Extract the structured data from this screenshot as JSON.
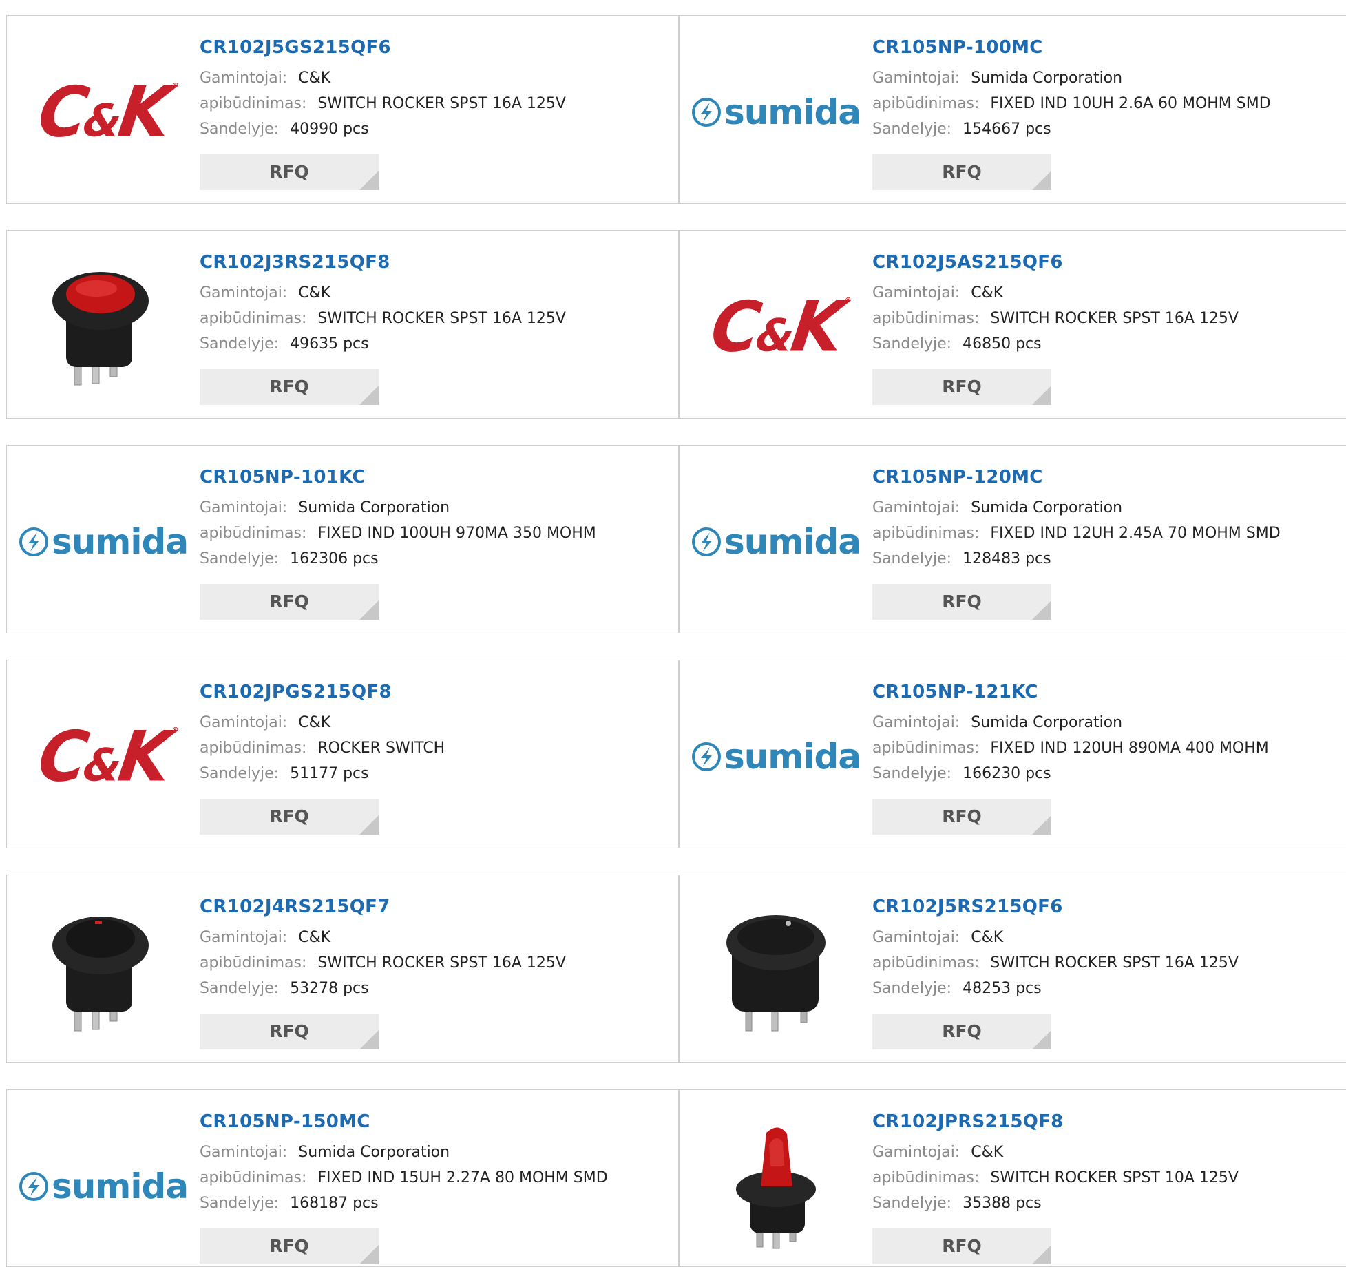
{
  "labels": {
    "manufacturer": "Gamintojai:",
    "description": "apibūdinimas:",
    "stock": "Sandelyje:",
    "rfq": "RFQ"
  },
  "brand_logos": {
    "ck": {
      "text_c": "C",
      "text_amp": "&",
      "text_k": "K",
      "reg": "®",
      "color": "#c8202a"
    },
    "sumida": {
      "text": "sumida",
      "color": "#2e87b8"
    }
  },
  "colors": {
    "part_number": "#1e6ab0",
    "label": "#8a8a8a",
    "value": "#222222",
    "rfq_bg": "#ececec",
    "border": "#cfcfcf"
  },
  "products": [
    {
      "part": "CR102J5GS215QF6",
      "manufacturer": "C&K",
      "description": "SWITCH ROCKER SPST 16A 125V",
      "stock": "40990 pcs",
      "image": "ck-logo"
    },
    {
      "part": "CR105NP-100MC",
      "manufacturer": "Sumida Corporation",
      "description": "FIXED IND 10UH 2.6A 60 MOHM SMD",
      "stock": "154667 pcs",
      "image": "sumida-logo"
    },
    {
      "part": "CR102J3RS215QF8",
      "manufacturer": "C&K",
      "description": "SWITCH ROCKER SPST 16A 125V",
      "stock": "49635 pcs",
      "image": "switch-red-round"
    },
    {
      "part": "CR102J5AS215QF6",
      "manufacturer": "C&K",
      "description": "SWITCH ROCKER SPST 16A 125V",
      "stock": "46850 pcs",
      "image": "ck-logo"
    },
    {
      "part": "CR105NP-101KC",
      "manufacturer": "Sumida Corporation",
      "description": "FIXED IND 100UH 970MA 350 MOHM",
      "stock": "162306 pcs",
      "image": "sumida-logo"
    },
    {
      "part": "CR105NP-120MC",
      "manufacturer": "Sumida Corporation",
      "description": "FIXED IND 12UH 2.45A 70 MOHM SMD",
      "stock": "128483 pcs",
      "image": "sumida-logo"
    },
    {
      "part": "CR102JPGS215QF8",
      "manufacturer": "C&K",
      "description": "ROCKER SWITCH",
      "stock": "51177 pcs",
      "image": "ck-logo"
    },
    {
      "part": "CR105NP-121KC",
      "manufacturer": "Sumida Corporation",
      "description": "FIXED IND 120UH 890MA 400 MOHM",
      "stock": "166230 pcs",
      "image": "sumida-logo"
    },
    {
      "part": "CR102J4RS215QF7",
      "manufacturer": "C&K",
      "description": "SWITCH ROCKER SPST 16A 125V",
      "stock": "53278 pcs",
      "image": "switch-black-round"
    },
    {
      "part": "CR102J5RS215QF6",
      "manufacturer": "C&K",
      "description": "SWITCH ROCKER SPST 16A 125V",
      "stock": "48253 pcs",
      "image": "switch-black-round-side"
    },
    {
      "part": "CR105NP-150MC",
      "manufacturer": "Sumida Corporation",
      "description": "FIXED IND 15UH 2.27A 80 MOHM SMD",
      "stock": "168187 pcs",
      "image": "sumida-logo"
    },
    {
      "part": "CR102JPRS215QF8",
      "manufacturer": "C&K",
      "description": "SWITCH ROCKER SPST 10A 125V",
      "stock": "35388 pcs",
      "image": "switch-red-tall"
    }
  ]
}
